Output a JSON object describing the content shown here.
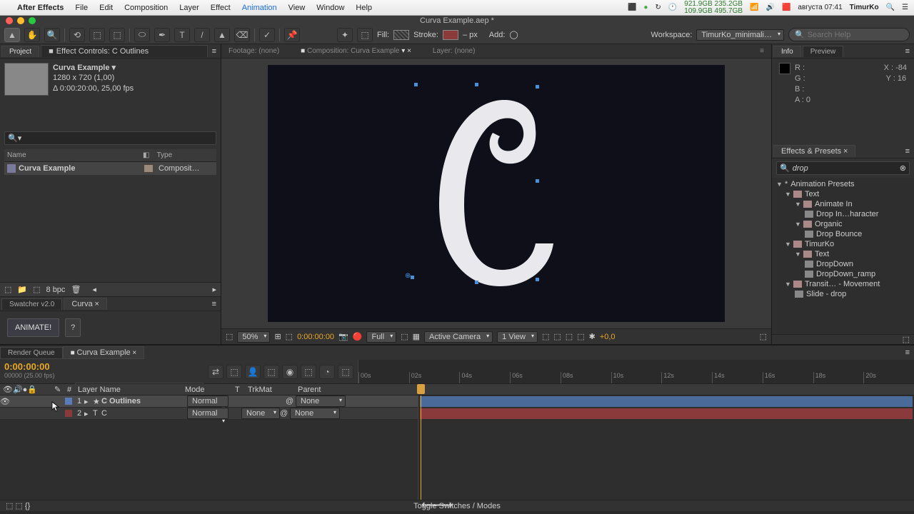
{
  "menubar": {
    "app": "After Effects",
    "items": [
      "File",
      "Edit",
      "Composition",
      "Layer",
      "Effect",
      "Animation",
      "View",
      "Window",
      "Help"
    ],
    "date": "августа 07:41",
    "user": "TimurKo",
    "stats_top": "921.9GB 235.2GB",
    "stats_bot": "109.9GB 495.7GB"
  },
  "window": {
    "title": "Curva Example.aep *"
  },
  "toolbar": {
    "fill_label": "Fill:",
    "stroke_label": "Stroke:",
    "stroke_px": "– px",
    "add_label": "Add:",
    "workspace_label": "Workspace:",
    "workspace_value": "TimurKo_minimali…",
    "search_placeholder": "Search Help"
  },
  "project": {
    "tab_project": "Project",
    "tab_effect_controls": "Effect Controls: C Outlines",
    "comp_name": "Curva Example ▾",
    "comp_dims": "1280 x 720 (1,00)",
    "comp_dur": "Δ 0:00:20:00, 25,00 fps",
    "col_name": "Name",
    "col_type": "Type",
    "row_name": "Curva Example",
    "row_type": "Composit…",
    "bpc": "8 bpc"
  },
  "curva": {
    "tab_swatcher": "Swatcher v2.0",
    "tab_curva": "Curva",
    "animate": "ANIMATE!",
    "help": "?"
  },
  "comp": {
    "footage": "Footage: (none)",
    "composition": "Composition: Curva Example",
    "layer": "Layer: (none)",
    "zoom": "50%",
    "timecode": "0:00:00:00",
    "res": "Full",
    "camera": "Active Camera",
    "views": "1 View",
    "exposure": "+0,0"
  },
  "info": {
    "tab_info": "Info",
    "tab_preview": "Preview",
    "r": "R :",
    "g": "G :",
    "b": "B :",
    "a": "A : 0",
    "x": "X : -84",
    "y": "Y : 16"
  },
  "eap": {
    "title": "Effects & Presets",
    "search": "drop",
    "nodes": {
      "animation_presets": "Animation Presets",
      "text": "Text",
      "animate_in": "Animate In",
      "drop_in": "Drop In…haracter",
      "organic": "Organic",
      "drop_bounce": "Drop Bounce",
      "timurko": "TimurKo",
      "text2": "Text",
      "dropdown": "DropDown",
      "dropdown_ramp": "DropDown_ramp",
      "transit": "Transit… - Movement",
      "slide_drop": "Slide - drop"
    }
  },
  "timeline": {
    "tab_render": "Render Queue",
    "tab_comp": "Curva Example",
    "timecode": "0:00:00:00",
    "frames": "00000 (25.00 fps)",
    "ruler": [
      "00s",
      "02s",
      "04s",
      "06s",
      "08s",
      "10s",
      "12s",
      "14s",
      "16s",
      "18s",
      "20s"
    ],
    "cols": {
      "hash": "#",
      "layer": "Layer Name",
      "mode": "Mode",
      "t": "T",
      "trkmat": "TrkMat",
      "parent": "Parent"
    },
    "layers": [
      {
        "num": "1",
        "name": "C Outlines",
        "mode": "Normal",
        "trkmat": "",
        "parent": "None",
        "color": "#5a7ab8",
        "sel": true,
        "star": "★"
      },
      {
        "num": "2",
        "name": "C",
        "mode": "Normal",
        "trkmat": "None",
        "parent": "None",
        "color": "#8a3a3a",
        "sel": false,
        "star": ""
      }
    ],
    "footer": "Toggle Switches / Modes"
  }
}
